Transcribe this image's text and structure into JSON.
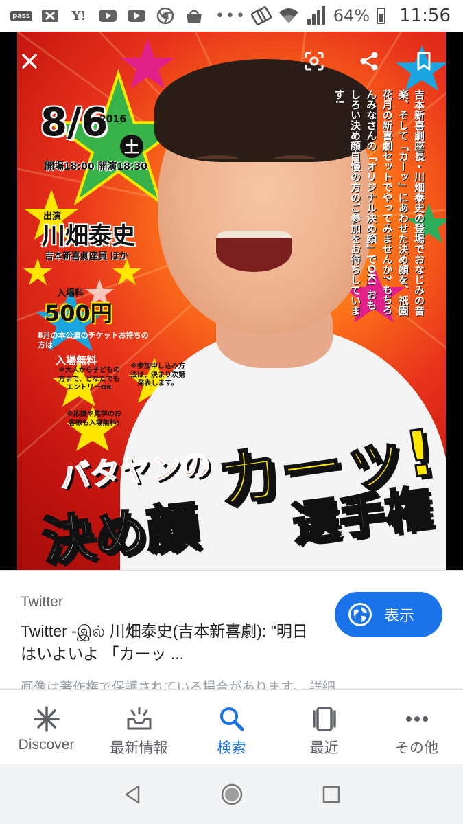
{
  "status_bar": {
    "battery_pct": "64%",
    "time": "11:56",
    "icons": [
      "pass-icon",
      "x-mail-icon",
      "yahoo-icon",
      "youtube-icon",
      "youtube-icon",
      "chrome-icon",
      "market-icon",
      "more-icon",
      "wifi-icon",
      "signal-icon",
      "battery-icon"
    ],
    "pass_label": "pass",
    "yahoo_label": "Y!",
    "more_label": "•••"
  },
  "viewer": {
    "icons": [
      "close-icon",
      "lens-icon",
      "share-icon",
      "bookmark-icon"
    ],
    "poster": {
      "date": "8/6",
      "year": "2016",
      "weekday": "土",
      "times": "開場18:00 開演18:30",
      "cast_label": "出演",
      "cast_name": "川畑泰史",
      "cast_sub": "吉本新喜劇座員 ほか",
      "fee_label": "入場料",
      "fee_value": "500円",
      "fee_note": "8月の本公演のチケットお持ちの方は",
      "fee_free": "入場無料",
      "note1": "※大人から子どもの方まで、どなたでもエントリーOK",
      "note2": "※参加申し込み方法は、決まり次第発表します。",
      "note3": "※応援や見学のお客様も入場無料!",
      "vertical_text": "吉本新喜劇座長・川畑泰史の登場でおなじみの音楽、そして「カーッ」にあわせた決め顔を、祇園花月の新喜劇セットでやってみませんか? もちろんみなさんの「オリジナル決め顔」でOK! おもしろい決め顔自慢の方のご参加をお待ちしています!",
      "title_small": "バタヤンの",
      "title_big1": "決め顔",
      "title_big2": "カーッ!",
      "title_big3": "選手権"
    }
  },
  "result": {
    "source": "Twitter",
    "title": "Twitter -இல் 川畑泰史(吉本新喜劇): \"明日はいよいよ 「カーッ ...",
    "visit_label": "表示",
    "copyright_note": "画像は著作権で保護されている場合があります。 詳細"
  },
  "bottom_nav": {
    "items": [
      {
        "label": "Discover",
        "icon": "asterisk-icon"
      },
      {
        "label": "最新情報",
        "icon": "updates-icon"
      },
      {
        "label": "検索",
        "icon": "search-icon"
      },
      {
        "label": "最近",
        "icon": "recent-tabs-icon"
      },
      {
        "label": "その他",
        "icon": "more-icon"
      }
    ],
    "active_index": 2
  },
  "colors": {
    "accent": "#1a73e8",
    "poster_red": "#e8331b",
    "poster_yellow": "#ffe600"
  }
}
